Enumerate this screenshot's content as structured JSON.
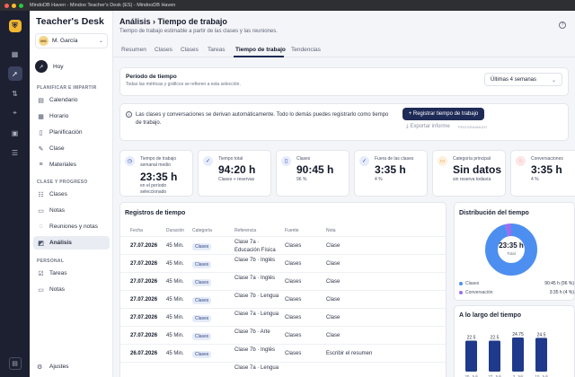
{
  "window": {
    "title": "MindoDB Haven - Mindoo Teacher's Desk (ES) - MindooDB Haven"
  },
  "sidebar": {
    "brand": "Teacher's Desk",
    "user": {
      "initials": "MG",
      "name": "M. García"
    },
    "home": "Hoy",
    "sections": {
      "plan": "PLANIFICAR E IMPARTIR",
      "classes": "CLASE Y PROGRESO",
      "personal": "PERSONAL"
    },
    "items": {
      "calendario": "Calendario",
      "horario": "Horario",
      "planificacion": "Planificación",
      "clase": "Clase",
      "materiales": "Materiales",
      "clases": "Clases",
      "notas": "Notas",
      "reuniones": "Reuniones y notas",
      "analisis": "Análisis",
      "tareas": "Tareas",
      "notas_personal": "Notas"
    },
    "settings": "Ajustes"
  },
  "header": {
    "title": "Análisis › Tiempo de trabajo",
    "subtitle": "Tiempo de trabajo estimable a partir de las clases y las reuniones."
  },
  "tabs": [
    "Resumen",
    "Clases",
    "Clases",
    "Tareas",
    "Tiempo de trabajo",
    "Tendencias"
  ],
  "period": {
    "label": "Período de tiempo",
    "sub": "Todas las métricas y gráficos se refieren a esta selección.",
    "selected": "Últimas 4 semanas"
  },
  "info": {
    "text": "Las clases y conversaciones se derivan automáticamente. Todo lo demás puedes registrarlo como tiempo de trabajo.",
    "register_button": "+ Registrar tiempo de trabajo",
    "export": "Exportar informe",
    "program_badge": "PROGRAMADO"
  },
  "stats": [
    {
      "icon": "clock-icon",
      "label": "Tiempo de trabajo semanal medio",
      "value": "23:35 h",
      "sub": "en el período seleccionado",
      "icon_bg": "#e6ecfb",
      "icon_fg": "#2f4cb0"
    },
    {
      "icon": "check-icon",
      "label": "Tiempo total",
      "value": "94:20 h",
      "sub": "Clases + reservas",
      "icon_bg": "#e6ecfb",
      "icon_fg": "#2f4cb0"
    },
    {
      "icon": "book-icon",
      "label": "Clases",
      "value": "90:45 h",
      "sub": "96 %",
      "icon_bg": "#e6ecfb",
      "icon_fg": "#2f4cb0"
    },
    {
      "icon": "check-circle-icon",
      "label": "Fuera de las clases",
      "value": "3:35 h",
      "sub": "4 %",
      "icon_bg": "#e6ecfb",
      "icon_fg": "#2f4cb0"
    },
    {
      "icon": "folder-icon",
      "label": "Categoría principal",
      "value": "Sin datos",
      "sub": "sin reserva todavía",
      "icon_bg": "#fdf0dc",
      "icon_fg": "#d5891c"
    },
    {
      "icon": "chat-icon",
      "label": "Conversaciones",
      "value": "3:35 h",
      "sub": "4 %",
      "icon_bg": "#fde6e6",
      "icon_fg": "#d04545"
    }
  ],
  "records": {
    "title": "Registros de tiempo",
    "headers": [
      "Fecha",
      "Duración",
      "Categoría",
      "Referencia",
      "Fuente",
      "Nota"
    ],
    "rows": [
      {
        "date": "27.07.2026",
        "duration": "45 Min.",
        "category": "Clases",
        "ref": "Clase 7a · Educación Física",
        "source": "Clases",
        "note": "Clase"
      },
      {
        "date": "27.07.2026",
        "duration": "45 Min.",
        "category": "Clases",
        "ref": "Clase 7b · Inglés",
        "source": "Clases",
        "note": "Clase"
      },
      {
        "date": "27.07.2026",
        "duration": "45 Min.",
        "category": "Clases",
        "ref": "Clase 7a · Inglés",
        "source": "Clases",
        "note": "Clase"
      },
      {
        "date": "27.07.2026",
        "duration": "45 Min.",
        "category": "Clases",
        "ref": "Clase 7b · Lengua",
        "source": "Clases",
        "note": "Clase"
      },
      {
        "date": "27.07.2026",
        "duration": "45 Min.",
        "category": "Clases",
        "ref": "Clase 7a · Lengua",
        "source": "Clases",
        "note": "Clase"
      },
      {
        "date": "27.07.2026",
        "duration": "45 Min.",
        "category": "Clases",
        "ref": "Clase 7b · Arte",
        "source": "Clases",
        "note": "Clase"
      },
      {
        "date": "26.07.2026",
        "duration": "45 Min.",
        "category": "Clases",
        "ref": "Clase 7b · Inglés",
        "source": "Clases",
        "note": "Escribir el resumen"
      },
      {
        "date": "",
        "duration": "",
        "category": "",
        "ref": "Clase 7a · Lengua",
        "source": "",
        "note": ""
      }
    ]
  },
  "distribution": {
    "title": "Distribución del tiempo",
    "center_value": "23:35 h",
    "center_label": "Total",
    "legend": [
      {
        "name": "Clases",
        "value": "90:45 h (96 %)",
        "color": "#4d8ff0",
        "pct": 96
      },
      {
        "name": "Conversación",
        "value": "3:35 h (4 %)",
        "color": "#9b6ef0",
        "pct": 4
      }
    ]
  },
  "chart_data": {
    "type": "bar",
    "title": "A lo largo del tiempo",
    "categories": [
      "20. Juli",
      "27. Juli",
      "3. Juli",
      "10. Juli"
    ],
    "values": [
      22.5,
      22.5,
      24.75,
      24.5
    ],
    "value_labels": [
      "22.5",
      "22.5",
      "24.75",
      "24.5"
    ],
    "ylim": [
      0,
      30
    ],
    "color": "#1f3a8a"
  }
}
